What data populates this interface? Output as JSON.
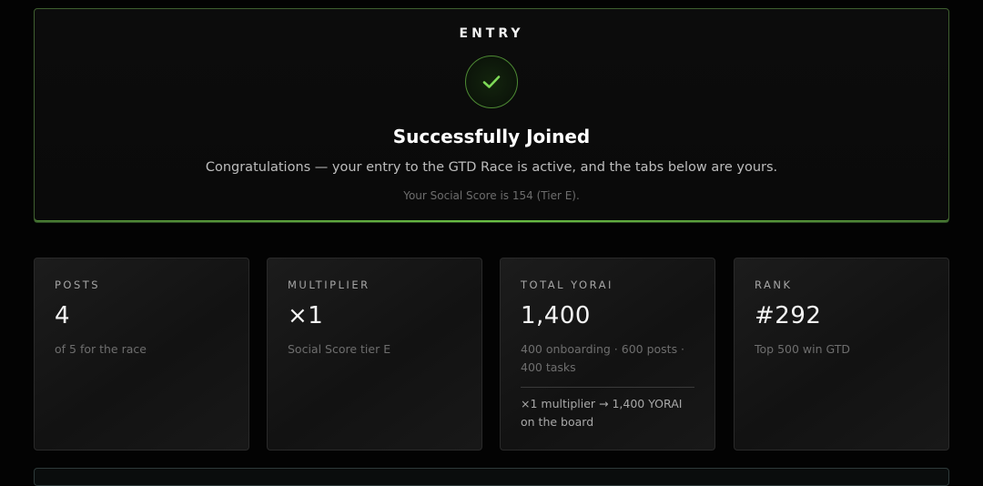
{
  "entry": {
    "heading": "ENTRY",
    "title": "Successfully Joined",
    "message": "Congratulations — your entry to the GTD Race is active, and the tabs below are yours.",
    "score_note": "Your Social Score is 154 (Tier E).",
    "icon": "check-icon",
    "accent_color": "#5aa13b"
  },
  "stats": [
    {
      "label": "POSTS",
      "value": "4",
      "sub": "of 5 for the race"
    },
    {
      "label": "MULTIPLIER",
      "value": "×1",
      "sub": "Social Score tier E"
    },
    {
      "label": "TOTAL YORAI",
      "value": "1,400",
      "sub": "400 onboarding · 600 posts · 400 tasks",
      "extra": "×1 multiplier → 1,400 YORAI on the board"
    },
    {
      "label": "RANK",
      "value": "#292",
      "sub": "Top 500 win GTD"
    }
  ]
}
